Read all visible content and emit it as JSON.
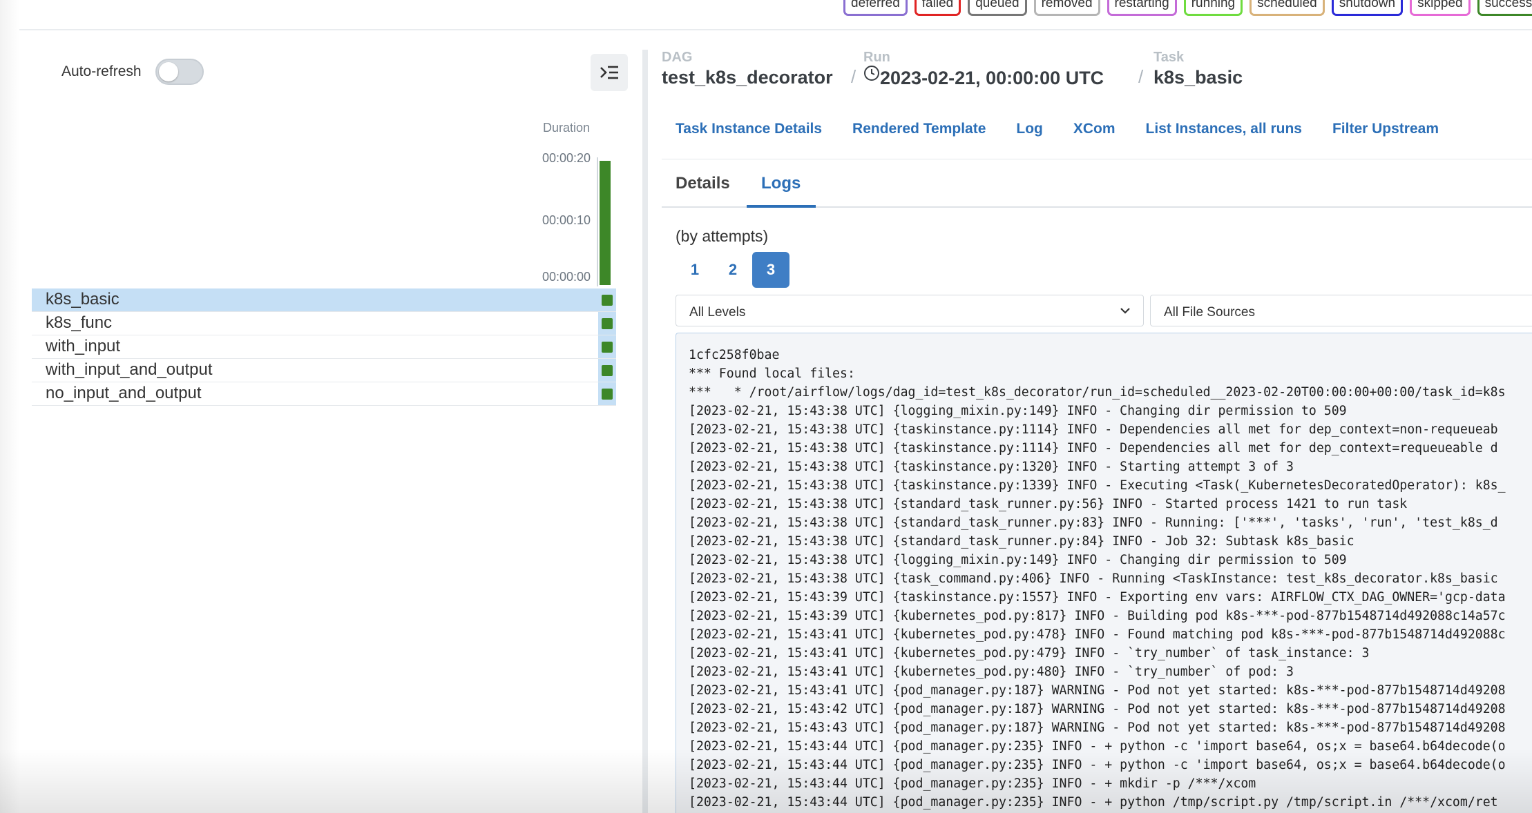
{
  "legend": {
    "states": [
      {
        "label": "deferred",
        "color": "#8a6fd1"
      },
      {
        "label": "failed",
        "color": "#e02424"
      },
      {
        "label": "queued",
        "color": "#777777"
      },
      {
        "label": "removed",
        "color": "#b5b5b5"
      },
      {
        "label": "restarting",
        "color": "#c46bd8"
      },
      {
        "label": "running",
        "color": "#6fdc3f"
      },
      {
        "label": "scheduled",
        "color": "#d8b27a"
      },
      {
        "label": "shutdown",
        "color": "#2a2ad8"
      },
      {
        "label": "skipped",
        "color": "#e66ad6"
      },
      {
        "label": "success",
        "color": "#3d8728"
      }
    ]
  },
  "grid": {
    "auto_refresh_label": "Auto-refresh",
    "auto_refresh_on": false,
    "collapse_icon": "collapse-panel-icon",
    "duration_label": "Duration",
    "duration_ticks": [
      "00:00:20",
      "00:00:10",
      "00:00:00"
    ],
    "run_duration_fraction": 1.0,
    "run_color": "#3d8728",
    "tasks": [
      {
        "name": "k8s_basic",
        "selected": true
      },
      {
        "name": "k8s_func",
        "selected": false
      },
      {
        "name": "with_input",
        "selected": false
      },
      {
        "name": "with_input_and_output",
        "selected": false
      },
      {
        "name": "no_input_and_output",
        "selected": false
      }
    ]
  },
  "breadcrumbs": {
    "dag_label": "DAG",
    "dag_value": "test_k8s_decorator",
    "run_label": "Run",
    "run_value": "2023-02-21, 00:00:00 UTC",
    "run_icon": "clock-icon",
    "task_label": "Task",
    "task_value": "k8s_basic",
    "separator": "/"
  },
  "nav_links": [
    "Task Instance Details",
    "Rendered Template",
    "Log",
    "XCom",
    "List Instances, all runs",
    "Filter Upstream"
  ],
  "tabs": {
    "details": "Details",
    "logs": "Logs",
    "active": "Logs"
  },
  "logs": {
    "by_attempts_label": "(by attempts)",
    "attempts": [
      "1",
      "2",
      "3"
    ],
    "active_attempt": "3",
    "level_select": "All Levels",
    "source_select": "All File Sources",
    "lines": [
      "1cfc258f0bae",
      "*** Found local files:",
      "***   * /root/airflow/logs/dag_id=test_k8s_decorator/run_id=scheduled__2023-02-20T00:00:00+00:00/task_id=k8s",
      "[2023-02-21, 15:43:38 UTC] {logging_mixin.py:149} INFO - Changing dir permission to 509",
      "[2023-02-21, 15:43:38 UTC] {taskinstance.py:1114} INFO - Dependencies all met for dep_context=non-requeueab",
      "[2023-02-21, 15:43:38 UTC] {taskinstance.py:1114} INFO - Dependencies all met for dep_context=requeueable d",
      "[2023-02-21, 15:43:38 UTC] {taskinstance.py:1320} INFO - Starting attempt 3 of 3",
      "[2023-02-21, 15:43:38 UTC] {taskinstance.py:1339} INFO - Executing <Task(_KubernetesDecoratedOperator): k8s_",
      "[2023-02-21, 15:43:38 UTC] {standard_task_runner.py:56} INFO - Started process 1421 to run task",
      "[2023-02-21, 15:43:38 UTC] {standard_task_runner.py:83} INFO - Running: ['***', 'tasks', 'run', 'test_k8s_d",
      "[2023-02-21, 15:43:38 UTC] {standard_task_runner.py:84} INFO - Job 32: Subtask k8s_basic",
      "[2023-02-21, 15:43:38 UTC] {logging_mixin.py:149} INFO - Changing dir permission to 509",
      "[2023-02-21, 15:43:38 UTC] {task_command.py:406} INFO - Running <TaskInstance: test_k8s_decorator.k8s_basic",
      "[2023-02-21, 15:43:39 UTC] {taskinstance.py:1557} INFO - Exporting env vars: AIRFLOW_CTX_DAG_OWNER='gcp-data",
      "[2023-02-21, 15:43:39 UTC] {kubernetes_pod.py:817} INFO - Building pod k8s-***-pod-877b1548714d492088c14a57c",
      "[2023-02-21, 15:43:41 UTC] {kubernetes_pod.py:478} INFO - Found matching pod k8s-***-pod-877b1548714d492088c",
      "[2023-02-21, 15:43:41 UTC] {kubernetes_pod.py:479} INFO - `try_number` of task_instance: 3",
      "[2023-02-21, 15:43:41 UTC] {kubernetes_pod.py:480} INFO - `try_number` of pod: 3",
      "[2023-02-21, 15:43:41 UTC] {pod_manager.py:187} WARNING - Pod not yet started: k8s-***-pod-877b1548714d49208",
      "[2023-02-21, 15:43:42 UTC] {pod_manager.py:187} WARNING - Pod not yet started: k8s-***-pod-877b1548714d49208",
      "[2023-02-21, 15:43:43 UTC] {pod_manager.py:187} WARNING - Pod not yet started: k8s-***-pod-877b1548714d49208",
      "[2023-02-21, 15:43:44 UTC] {pod_manager.py:235} INFO - + python -c 'import base64, os;x = base64.b64decode(o",
      "[2023-02-21, 15:43:44 UTC] {pod_manager.py:235} INFO - + python -c 'import base64, os;x = base64.b64decode(o",
      "[2023-02-21, 15:43:44 UTC] {pod_manager.py:235} INFO - + mkdir -p /***/xcom",
      "[2023-02-21, 15:43:44 UTC] {pod_manager.py:235} INFO - + python /tmp/script.py /tmp/script.in /***/xcom/ret"
    ]
  }
}
